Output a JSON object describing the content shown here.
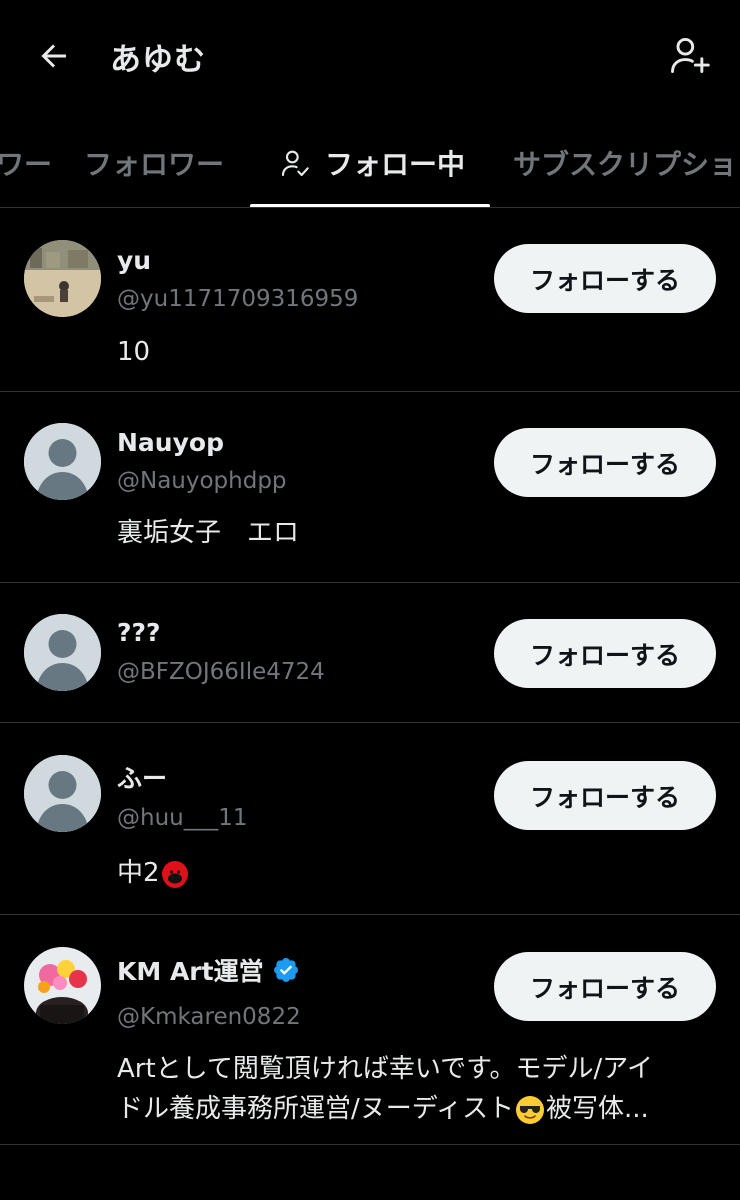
{
  "header": {
    "title": "あゆむ",
    "back_icon": "arrow-left-icon",
    "add_user_icon": "person-add-icon"
  },
  "tabs": [
    {
      "label": "ワー",
      "active": false
    },
    {
      "label": "フォロワー",
      "active": false
    },
    {
      "label": "フォロー中",
      "active": true,
      "icon": "person-check-icon"
    },
    {
      "label": "サブスクリプショ",
      "active": false
    }
  ],
  "users": [
    {
      "name": "yu",
      "handle": "@yu1171709316959",
      "bio": "10",
      "button": "フォローする",
      "avatar": "photo"
    },
    {
      "name": "Nauyop",
      "handle": "@Nauyophdpp",
      "bio": "裏垢女子　エロ",
      "button": "フォローする",
      "avatar": "default"
    },
    {
      "name": "???",
      "handle": "@BFZOJ66Ile4724",
      "bio": "",
      "button": "フォローする",
      "avatar": "default"
    },
    {
      "name": "ふー",
      "handle": "@huu___11",
      "bio": "中2",
      "bio_emoji": "red-face-emoji",
      "button": "フォローする",
      "avatar": "default"
    },
    {
      "name": "KM Art運営",
      "verified": true,
      "handle": "@Kmkaren0822",
      "bio_line1": "Artとして閲覧頂ければ幸いです。モデル/アイ",
      "bio_line2a": "ドル養成事務所運営/ヌーディスト",
      "bio_emoji": "sunglasses-emoji",
      "bio_line2b": "被写体...",
      "button": "フォローする",
      "avatar": "photo"
    }
  ],
  "colors": {
    "background": "#000000",
    "text": "#e7e9ea",
    "muted": "#71767b",
    "border": "#2f3336",
    "button_bg": "#eff3f4",
    "verified": "#1d9bf0"
  }
}
